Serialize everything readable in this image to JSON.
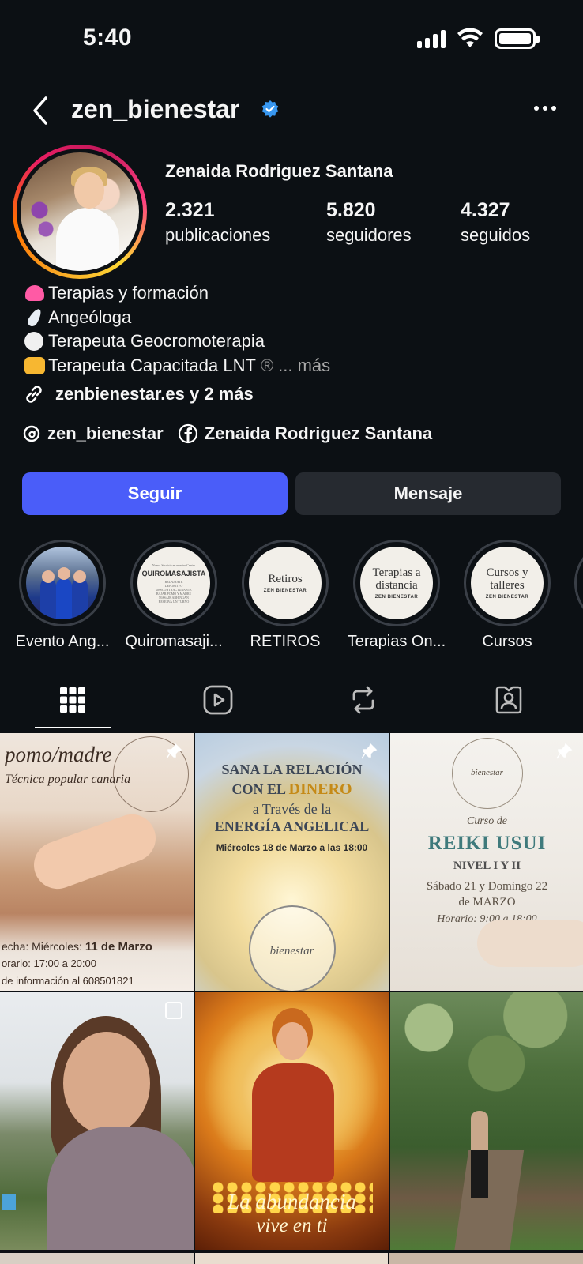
{
  "status_bar": {
    "time": "5:40"
  },
  "header": {
    "username": "zen_bienestar"
  },
  "profile": {
    "full_name": "Zenaida Rodriguez Santana",
    "stats": {
      "posts": {
        "value": "2.321",
        "label": "publicaciones"
      },
      "followers": {
        "value": "5.820",
        "label": "seguidores"
      },
      "following": {
        "value": "4.327",
        "label": "seguidos"
      }
    },
    "bio": [
      {
        "emoji": "heart-emoji",
        "text": "Terapias y formación"
      },
      {
        "emoji": "feather-emoji",
        "text": "Angeóloga"
      },
      {
        "emoji": "white-circle-emoji",
        "text": "Terapeuta Geocromoterapia"
      },
      {
        "emoji": "raised-hands-emoji",
        "text": "Terapeuta Capacitada LNT"
      }
    ],
    "bio_reg": "®",
    "bio_more": "... más",
    "link": "zenbienestar.es y 2 más",
    "threads_handle": "zen_bienestar",
    "facebook_name": "Zenaida Rodriguez Santana"
  },
  "buttons": {
    "follow": "Seguir",
    "message": "Mensaje"
  },
  "highlights": [
    {
      "label": "Evento Ang...",
      "cover": "photo"
    },
    {
      "label": "Quiromasaji...",
      "cover_title": "QUIROMASAJISTA",
      "cover_header": "Nueva Servicio en nuestro Centro",
      "cover_lines": [
        "RELAJANTE",
        "DEPORTIVO",
        "DESCONTRACTURANTE",
        "BAJAR POMO Y MADRE",
        "MASAJE ABHINGAN"
      ],
      "cover_footer": "RESERVA UN TURNO"
    },
    {
      "label": "RETIROS",
      "cover_title": "Retiros",
      "cover_sub": "ZEN BIENESTAR"
    },
    {
      "label": "Terapias On...",
      "cover_title": "Terapias a distancia",
      "cover_sub": "ZEN BIENESTAR"
    },
    {
      "label": "Cursos",
      "cover_title": "Cursos y talleres",
      "cover_sub": "ZEN BIENESTAR"
    }
  ],
  "tabs": [
    "grid-icon",
    "reels-icon",
    "reposts-icon",
    "tagged-icon"
  ],
  "posts": {
    "p1": {
      "title": "pomo/madre",
      "subtitle": "Técnica popular canaria",
      "date_label": "echa: Miércoles:",
      "date_value": "11 de Marzo",
      "time": "orario: 17:00 a 20:00",
      "info": "de información al 608501821"
    },
    "p2": {
      "line1": "SANA LA RELACIÓN",
      "line2_a": "CON EL ",
      "line2_b": "DINERO",
      "line3": "a Través de la",
      "line4": "ENERGÍA ANGELICAL",
      "line5": "Miércoles 18 de Marzo a las 18:00",
      "seal_text": "bienestar"
    },
    "p3": {
      "seal_text": "bienestar",
      "course": "Curso de",
      "title": "REIKI USUI",
      "level": "NIVEL I Y II",
      "dates_1": "Sábado 21 y Domingo 22",
      "dates_2": "de MARZO",
      "schedule": "Horario: 9:00 a 18:00"
    },
    "p5": {
      "line1": "La abundancia",
      "line2": "vive en ti"
    }
  },
  "colors": {
    "follow_button": "#4a5df9",
    "message_button": "#262a30",
    "verified": "#3897f0",
    "background": "#0c1014"
  }
}
